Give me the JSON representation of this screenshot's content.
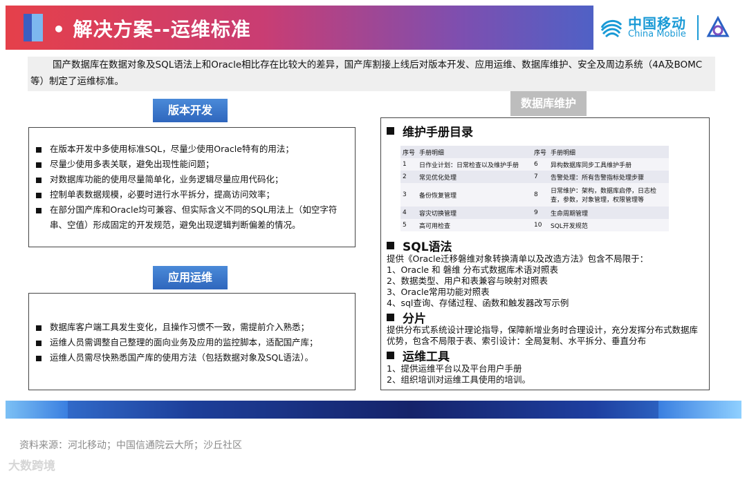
{
  "header": {
    "title": "• 解决方案--运维标准"
  },
  "logo": {
    "name_cn": "中国移动",
    "name_en": "China Mobile"
  },
  "intro": "国产数据库在数据对象及SQL语法上和Oracle相比存在比较大的差异，国产库割接上线后对版本开发、应用运维、数据库维护、安全及周边系统（4A及BOMC等）制定了运维标准。",
  "dev": {
    "title": "版本开发",
    "items": [
      "在版本开发中多使用标准SQL，尽量少使用Oracle特有的用法；",
      "尽量少使用多表关联，避免出现性能问题；",
      "对数据库功能的使用尽量简单化，业务逻辑尽量应用代码化；",
      "控制单表数据规模，必要时进行水平拆分，提高访问效率；",
      "在部分国产库和Oracle均可兼容、但实际含义不同的SQL用法上（如空字符串、空值）形成固定的开发规范，避免出现逻辑判断偏差的情况。"
    ]
  },
  "ops": {
    "title": "应用运维",
    "items": [
      "数据库客户端工具发生变化，且操作习惯不一致，需提前介入熟悉；",
      "运维人员需调整自己整理的面向业务及应用的监控脚本，适配国产库；",
      "运维人员需尽快熟悉国产库的使用方法（包括数据对象及SQL语法）。"
    ]
  },
  "dbm": {
    "title": "数据库维护",
    "manual_heading": "维护手册目录",
    "table_header": {
      "no1": "序号",
      "d1": "手册明细",
      "no2": "序号",
      "d2": "手册明细"
    },
    "table_rows": [
      {
        "no1": "1",
        "d1": "日作业计划：日常检查以及维护手册",
        "no2": "6",
        "d2": "异构数据库同步工具维护手册"
      },
      {
        "no1": "2",
        "d1": "常见优化处理",
        "no2": "7",
        "d2": "告警处理：所有告警指标处理步骤"
      },
      {
        "no1": "3",
        "d1": "备份恢复管理",
        "no2": "8",
        "d2": "日常维护：架构，数据库启停，日志检查，参数，对象管理，权限管理等"
      },
      {
        "no1": "4",
        "d1": "容灾切换管理",
        "no2": "9",
        "d2": "生命周期管理"
      },
      {
        "no1": "5",
        "d1": "高可用检查",
        "no2": "10",
        "d2": "SQL开发规范"
      }
    ],
    "sql_heading": "SQL语法",
    "sql_lines": [
      "提供《Oracle迁移磐维对象转换清单以及改造方法》包含不局限于：",
      "1、Oracle 和 磐维 分布式数据库术语对照表",
      "2、数据类型、用户和表兼容与映射对照表",
      "3、Oracle常用功能对照表",
      "4、sql查询、存储过程、函数和触发器改写示例"
    ],
    "shard_heading": "分片",
    "shard_text": "提供分布式系统设计理论指导，保障新增业务时合理设计，充分发挥分布式数据库优势，包含不局限于表、索引设计：全局复制、水平拆分、垂直分布",
    "tools_heading": "运维工具",
    "tools_lines": [
      "1、提供运维平台以及平台用户手册",
      "2、组织培训对运维工具使用的培训。"
    ]
  },
  "footer": {
    "source": "资料来源：河北移动；中国信通院云大所；沙丘社区",
    "watermark": "大数跨境"
  }
}
